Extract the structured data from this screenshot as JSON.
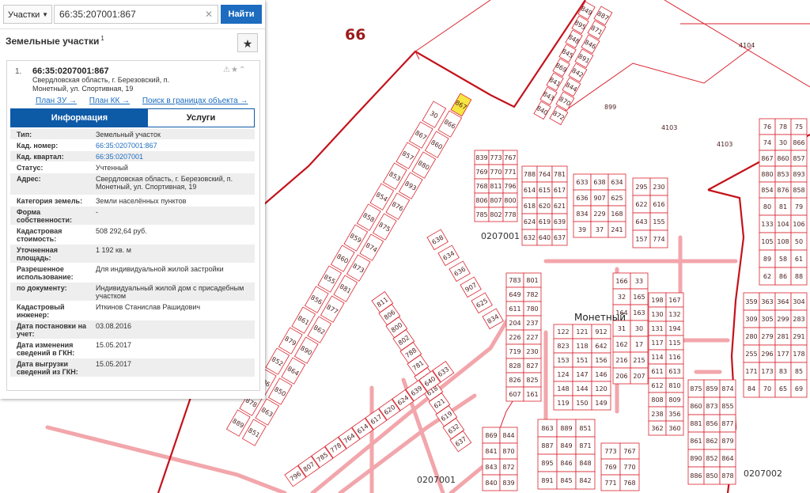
{
  "search": {
    "type_label": "Участки",
    "query": "66:35:207001:867",
    "button_label": "Найти"
  },
  "panel": {
    "title": "Земельные участки",
    "title_sup": "1"
  },
  "result": {
    "index": "1.",
    "cad_number": "66:35:0207001:867",
    "address_line1": "Свердловская область, г. Березовский, п.",
    "address_line2": "Монетный, ул. Спортивная, 19",
    "links": [
      "План ЗУ →",
      "План КК →",
      "Поиск в границах объекта →"
    ],
    "tabs": [
      "Информация",
      "Услуги"
    ],
    "info_rows": [
      {
        "label": "Тип:",
        "value": "Земельный участок"
      },
      {
        "label": "Кад. номер:",
        "value": "66:35:0207001:867"
      },
      {
        "label": "Кад. квартал:",
        "value": "66:35:0207001"
      },
      {
        "label": "Статус:",
        "value": "Учтенный"
      },
      {
        "label": "Адрес:",
        "value": "Свердловская область, г. Березовский, п. Монетный, ул. Спортивная, 19"
      },
      {
        "label": "Категория земель:",
        "value": "Земли населённых пунктов"
      },
      {
        "label": "Форма собственности:",
        "value": "-"
      },
      {
        "label": "Кадастровая стоимость:",
        "value": "508 292,64 руб."
      },
      {
        "label": "Уточненная площадь:",
        "value": "1 192 кв. м"
      },
      {
        "label": "Разрешенное использование:",
        "value": "Для индивидуальной жилой застройки"
      },
      {
        "label": "по документу:",
        "value": "Индивидуальный жилой дом с присадебным участком"
      },
      {
        "label": "Кадастровый инженер:",
        "value": "Иткинов Станислав Рашидович"
      },
      {
        "label": "Дата постановки на учет:",
        "value": "03.08.2016"
      },
      {
        "label": "Дата изменения сведений в ГКН:",
        "value": "15.05.2017"
      },
      {
        "label": "Дата выгрузки сведений из ГКН:",
        "value": "15.05.2017"
      }
    ]
  },
  "map": {
    "region_label": "66",
    "settlement_label": "Монетный",
    "quarter_labels": [
      "0207001",
      "0207001",
      "0207002"
    ],
    "big_parcels": [
      "4104",
      "899",
      "4103",
      "4103"
    ],
    "selected_parcel": "867",
    "parcel_labels": [
      "30",
      "866",
      "867",
      "860",
      "857",
      "880",
      "853",
      "893",
      "854",
      "876",
      "858",
      "875",
      "859",
      "874",
      "860",
      "873",
      "855",
      "881",
      "856",
      "877",
      "861",
      "862",
      "879",
      "890",
      "852",
      "864",
      "886",
      "850",
      "878",
      "863",
      "889",
      "851",
      "887",
      "849",
      "871",
      "895",
      "846",
      "848",
      "891",
      "845",
      "842",
      "869",
      "844",
      "841",
      "870",
      "843",
      "872",
      "840",
      "839",
      "773",
      "767",
      "769",
      "770",
      "771",
      "768",
      "811",
      "796",
      "806",
      "807",
      "800",
      "785",
      "802",
      "778",
      "788",
      "764",
      "781",
      "614",
      "615",
      "617",
      "618",
      "620",
      "621",
      "624",
      "619",
      "639",
      "632",
      "640",
      "637",
      "633",
      "638",
      "634",
      "636",
      "907",
      "625",
      "834",
      "229",
      "168",
      "39",
      "37",
      "241",
      "295",
      "230",
      "622",
      "616",
      "643",
      "155",
      "157",
      "774",
      "783",
      "801",
      "649",
      "782",
      "611",
      "780",
      "204",
      "237",
      "226",
      "227",
      "719",
      "230",
      "828",
      "827",
      "826",
      "825",
      "607",
      "161",
      "122",
      "121",
      "912",
      "823",
      "118",
      "642",
      "153",
      "151",
      "156",
      "124",
      "147",
      "146",
      "148",
      "144",
      "120",
      "119",
      "150",
      "149",
      "166",
      "33",
      "32",
      "165",
      "164",
      "163",
      "31",
      "30",
      "162",
      "17",
      "216",
      "215",
      "206",
      "207",
      "198",
      "167",
      "130",
      "132",
      "131",
      "194",
      "117",
      "115",
      "114",
      "116",
      "611",
      "613",
      "612",
      "810",
      "808",
      "809",
      "238",
      "356",
      "362",
      "360",
      "359",
      "363",
      "364",
      "304",
      "309",
      "305",
      "299",
      "283",
      "280",
      "279",
      "281",
      "291",
      "255",
      "296",
      "177",
      "178",
      "171",
      "173",
      "83",
      "85",
      "84",
      "70",
      "65",
      "69",
      "80",
      "81",
      "79",
      "133",
      "104",
      "106",
      "105",
      "108",
      "50",
      "89",
      "58",
      "61",
      "62",
      "86",
      "88",
      "76",
      "78",
      "75",
      "74"
    ]
  }
}
